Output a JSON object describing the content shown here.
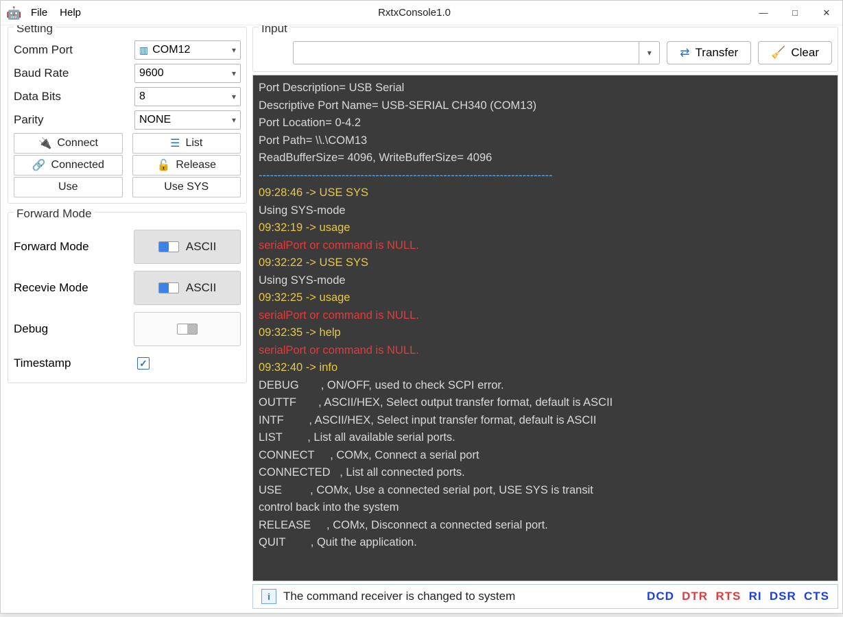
{
  "window": {
    "title": "RxtxConsole1.0",
    "menu": {
      "file": "File",
      "help": "Help"
    }
  },
  "setting": {
    "title": "Setting",
    "comm_port_label": "Comm Port",
    "comm_port_value": "COM12",
    "baud_rate_label": "Baud Rate",
    "baud_rate_value": "9600",
    "data_bits_label": "Data Bits",
    "data_bits_value": "8",
    "parity_label": "Parity",
    "parity_value": "NONE",
    "connect": "Connect",
    "list": "List",
    "connected": "Connected",
    "release": "Release",
    "use": "Use",
    "use_sys": "Use SYS"
  },
  "forward": {
    "title": "Forward Mode",
    "forward_label": "Forward Mode",
    "forward_value": "ASCII",
    "receive_label": "Recevie Mode",
    "receive_value": "ASCII",
    "debug_label": "Debug",
    "timestamp_label": "Timestamp",
    "timestamp_checked": true
  },
  "input": {
    "title": "Input",
    "transfer": "Transfer",
    "clear": "Clear",
    "value": ""
  },
  "console_lines": [
    {
      "cls": "",
      "text": "Port Description= USB Serial"
    },
    {
      "cls": "",
      "text": "Descriptive Port Name= USB-SERIAL CH340 (COM13)"
    },
    {
      "cls": "",
      "text": "Port Location= 0-4.2"
    },
    {
      "cls": "",
      "text": "Port Path= \\\\.\\COM13"
    },
    {
      "cls": "",
      "text": "ReadBufferSize= 4096, WriteBufferSize= 4096"
    },
    {
      "cls": "sep",
      "text": "------------------------------------------------------------------------------"
    },
    {
      "cls": "yellow",
      "text": "09:28:46 -> USE SYS"
    },
    {
      "cls": "",
      "text": "Using SYS-mode"
    },
    {
      "cls": "yellow",
      "text": "09:32:19 -> usage"
    },
    {
      "cls": "red",
      "text": "serialPort or command is NULL."
    },
    {
      "cls": "yellow",
      "text": "09:32:22 -> USE SYS"
    },
    {
      "cls": "",
      "text": "Using SYS-mode"
    },
    {
      "cls": "yellow",
      "text": "09:32:25 -> usage"
    },
    {
      "cls": "red",
      "text": "serialPort or command is NULL."
    },
    {
      "cls": "yellow",
      "text": "09:32:35 -> help"
    },
    {
      "cls": "red",
      "text": "serialPort or command is NULL."
    },
    {
      "cls": "yellow",
      "text": "09:32:40 -> info"
    },
    {
      "cls": "",
      "text": "DEBUG       , ON/OFF, used to check SCPI error."
    },
    {
      "cls": "",
      "text": "OUTTF       , ASCII/HEX, Select output transfer format, default is ASCII"
    },
    {
      "cls": "",
      "text": "INTF        , ASCII/HEX, Select input transfer format, default is ASCII"
    },
    {
      "cls": "",
      "text": "LIST        , List all available serial ports."
    },
    {
      "cls": "",
      "text": "CONNECT     , COMx, Connect a serial port"
    },
    {
      "cls": "",
      "text": "CONNECTED   , List all connected ports."
    },
    {
      "cls": "",
      "text": "USE         , COMx, Use a connected serial port, USE SYS is transit"
    },
    {
      "cls": "",
      "text": "control back into the system"
    },
    {
      "cls": "",
      "text": "RELEASE     , COMx, Disconnect a connected serial port."
    },
    {
      "cls": "",
      "text": "QUIT        , Quit the application."
    }
  ],
  "status": {
    "message": "The command receiver is changed to system",
    "signals": [
      {
        "name": "DCD",
        "cls": "sig-blue"
      },
      {
        "name": "DTR",
        "cls": "sig-red"
      },
      {
        "name": "RTS",
        "cls": "sig-red"
      },
      {
        "name": "RI",
        "cls": "sig-blue"
      },
      {
        "name": "DSR",
        "cls": "sig-blue"
      },
      {
        "name": "CTS",
        "cls": "sig-blue"
      }
    ]
  }
}
